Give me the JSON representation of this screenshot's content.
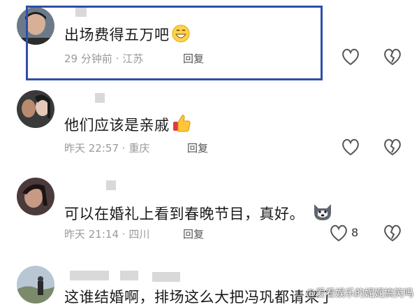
{
  "comments": [
    {
      "text": "出场费得五万吧",
      "time": "29 分钟前",
      "location": "江苏",
      "reply_label": "回复",
      "emoji": "grinning-emoji",
      "highlighted": true
    },
    {
      "text": "他们应该是亲戚",
      "time": "昨天 22:57",
      "location": "重庆",
      "reply_label": "回复",
      "emoji": "thumbs-up-emoji"
    },
    {
      "text": "可以在婚礼上看到春晚节目，真好。",
      "time": "昨天 21:14",
      "location": "四川",
      "reply_label": "回复",
      "emoji": "husky-emoji",
      "like_count": "8"
    },
    {
      "text": "这谁结婚啊，排场这么大把冯巩都请来了"
    }
  ],
  "separator": "·",
  "watermark": "@爱看娱乐的妮妮搞笑吗",
  "colors": {
    "highlight_border": "#2f4ea8",
    "meta_text": "#9a9a9a"
  }
}
